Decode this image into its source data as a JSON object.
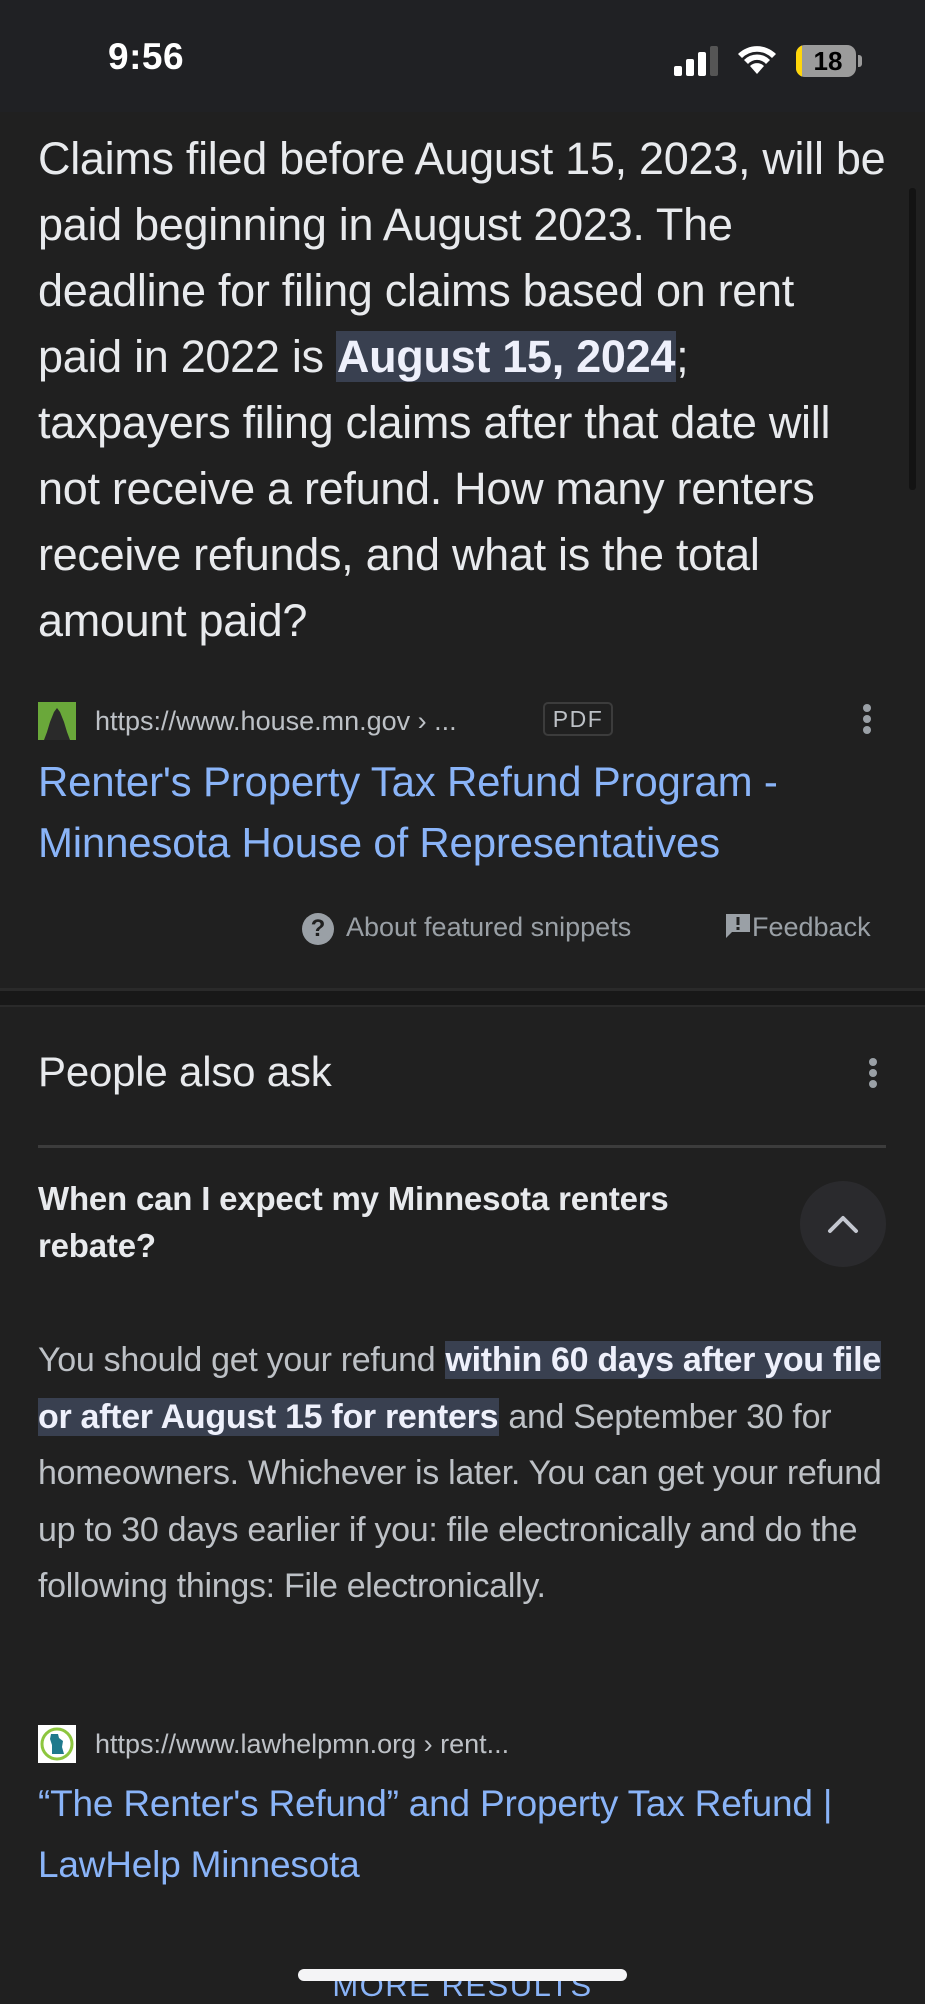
{
  "status_bar": {
    "time": "9:56",
    "signal_icon": "cellular-signal-icon",
    "wifi_icon": "wifi-icon",
    "battery_percent": 18,
    "battery_label": "18"
  },
  "featured_snippet": {
    "text_before": "Claims filed before August 15, 2023, will be paid beginning in August 2023. The deadline for filing claims based on rent paid in 2022 is ",
    "highlight": "August 15, 2024",
    "text_after": "; taxpayers filing claims after that date will not receive a refund. How many renters receive refunds, and what is the total amount paid?",
    "source": {
      "favicon": "mn-house-capitol-icon",
      "url": "https://www.house.mn.gov › ...",
      "badge": "PDF",
      "more_icon": "more-vert-icon"
    },
    "title_line1": "Renter's Property Tax Refund Program -",
    "title_line2": "Minnesota House of Representatives",
    "about_label": "About featured snippets",
    "feedback_label": "Feedback"
  },
  "people_also_ask": {
    "title": "People also ask",
    "more_icon": "more-vert-icon",
    "question": "When can I expect my Minnesota renters rebate?",
    "expanded": true,
    "answer": {
      "text_before": "You should get your refund ",
      "highlight": "within 60 days after you file or after August 15 for renters",
      "text_after": " and September 30 for homeowners. Whichever is later. You can get your refund up to 30 days earlier if you: file electronically and do the following things: File electronically."
    },
    "source": {
      "favicon": "lawhelp-mn-icon",
      "url": "https://www.lawhelpmn.org › rent..."
    },
    "title_line1": "“The Renter's Refund” and Property Tax Refund |",
    "title_line2": "LawHelp Minnesota"
  },
  "more_results_label": "MORE RESULTS",
  "colors": {
    "background": "#202020",
    "link": "#8ab4f8",
    "highlight_bg": "#394050",
    "text": "#e8eaed",
    "muted": "#9aa0a6"
  }
}
